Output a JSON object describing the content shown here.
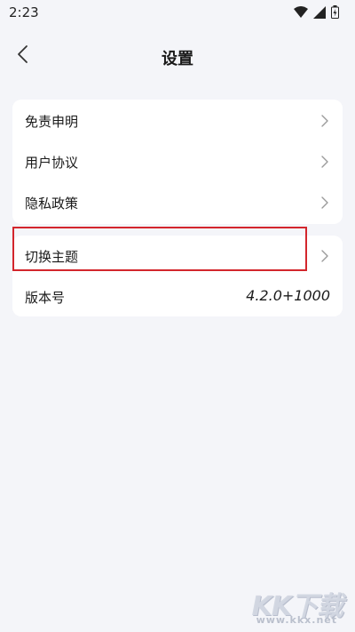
{
  "status_bar": {
    "time": "2:23",
    "icons": [
      "wifi-icon",
      "signal-icon",
      "battery-icon"
    ]
  },
  "header": {
    "back_icon": "chevron-left-icon",
    "title": "设置"
  },
  "settings_group_1": {
    "items": [
      {
        "label": "免责申明",
        "icon": "chevron-right-icon"
      },
      {
        "label": "用户协议",
        "icon": "chevron-right-icon"
      },
      {
        "label": "隐私政策",
        "icon": "chevron-right-icon"
      }
    ]
  },
  "settings_group_2": {
    "items": [
      {
        "label": "切换主题",
        "icon": "chevron-right-icon"
      },
      {
        "label": "版本号",
        "value": "4.2.0+1000"
      }
    ]
  },
  "highlight": {
    "color": "#d3262d"
  },
  "watermark": {
    "logo": "KK下载",
    "site": "www.kkx.net"
  },
  "colors": {
    "background": "#f4f5f9",
    "card": "#ffffff",
    "chevron": "#9a9a9a",
    "text": "#1a1a1a"
  }
}
